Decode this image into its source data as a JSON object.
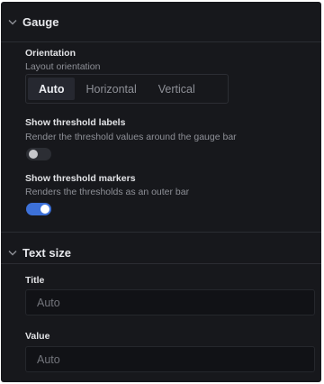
{
  "gauge_section": {
    "title": "Gauge",
    "expanded": true,
    "icon": "chevron-down-icon"
  },
  "orientation": {
    "label": "Orientation",
    "description": "Layout orientation",
    "options": [
      "Auto",
      "Horizontal",
      "Vertical"
    ],
    "selected": "Auto"
  },
  "threshold_labels": {
    "label": "Show threshold labels",
    "description": "Render the threshold values around the gauge bar",
    "enabled": false
  },
  "threshold_markers": {
    "label": "Show threshold markers",
    "description": "Renders the thresholds as an outer bar",
    "enabled": true
  },
  "text_size_section": {
    "title": "Text size",
    "expanded": true,
    "icon": "chevron-down-icon"
  },
  "title_field": {
    "label": "Title",
    "placeholder": "Auto",
    "value": ""
  },
  "value_field": {
    "label": "Value",
    "placeholder": "Auto",
    "value": ""
  },
  "colors": {
    "panel_bg": "#17181c",
    "accent": "#3d71d9",
    "text_primary": "#e2e3e6",
    "text_secondary": "#8e9097"
  }
}
